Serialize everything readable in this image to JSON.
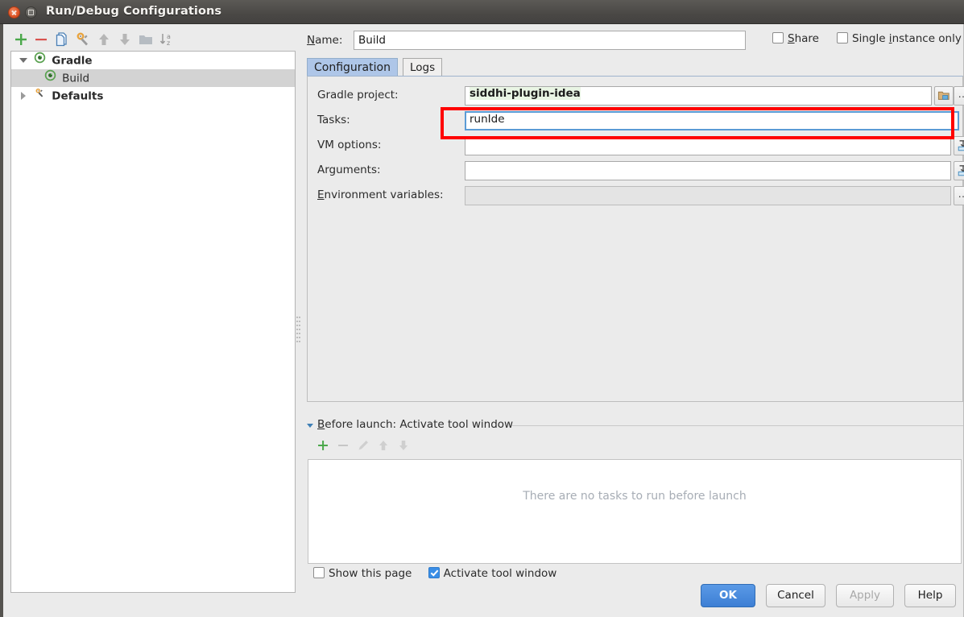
{
  "window": {
    "title": "Run/Debug Configurations",
    "close_icon": "close-icon",
    "maximize_icon": "maximize-icon"
  },
  "left_toolbar": {
    "buttons": [
      {
        "name": "add-configuration-button",
        "icon": "plus-icon",
        "enabled": true
      },
      {
        "name": "remove-configuration-button",
        "icon": "minus-icon",
        "enabled": true
      },
      {
        "name": "copy-configuration-button",
        "icon": "copy-icon",
        "enabled": true
      },
      {
        "name": "edit-defaults-button",
        "icon": "wrench-icon",
        "enabled": true
      },
      {
        "name": "move-up-button",
        "icon": "arrow-up-icon",
        "enabled": false
      },
      {
        "name": "move-down-button",
        "icon": "arrow-down-icon",
        "enabled": false
      },
      {
        "name": "new-folder-button",
        "icon": "folder-icon",
        "enabled": false
      },
      {
        "name": "sort-configurations-button",
        "icon": "sort-alpha-icon",
        "enabled": false
      }
    ]
  },
  "tree": {
    "nodes": [
      {
        "label": "Gradle",
        "icon": "gradle-icon",
        "expanded": true,
        "depth": 0,
        "bold": true,
        "selected": false,
        "has_toggle": true
      },
      {
        "label": "Build",
        "icon": "gradle-icon",
        "expanded": false,
        "depth": 1,
        "bold": false,
        "selected": true,
        "has_toggle": false
      },
      {
        "label": "Defaults",
        "icon": "wrench-icon",
        "expanded": false,
        "depth": 0,
        "bold": true,
        "selected": false,
        "has_toggle": true
      }
    ]
  },
  "name_row": {
    "label": "Name:",
    "label_mnemonic": "N",
    "value": "Build",
    "placeholder": "",
    "share": {
      "label": "Share",
      "mnemonic": "S",
      "checked": false
    },
    "single_instance": {
      "label": "Single instance only",
      "mnemonic": "i",
      "checked": false
    }
  },
  "tabs": [
    {
      "label": "Configuration",
      "active": true
    },
    {
      "label": "Logs",
      "active": false
    }
  ],
  "config": {
    "fields": [
      {
        "label": "Gradle project:",
        "mnemonic": "",
        "value": "siddhi-plugin-idea",
        "value_highlighted": true,
        "disabled": false,
        "focused": false,
        "buttons": [
          {
            "name": "browse-gradle-project-button",
            "icon": "folder-open-icon",
            "label": ""
          },
          {
            "name": "gradle-project-more-button",
            "icon": "ellipsis-icon",
            "label": "…"
          }
        ]
      },
      {
        "label": "Tasks:",
        "mnemonic": "",
        "value": "runIde",
        "value_highlighted": false,
        "disabled": false,
        "focused": true,
        "buttons": []
      },
      {
        "label": "VM options:",
        "mnemonic": "",
        "value": "",
        "value_highlighted": false,
        "disabled": false,
        "focused": false,
        "buttons": [
          {
            "name": "vm-options-expand-button",
            "icon": "expand-editor-icon",
            "label": ""
          }
        ]
      },
      {
        "label": "Arguments:",
        "mnemonic": "",
        "value": "",
        "value_highlighted": false,
        "disabled": false,
        "focused": false,
        "buttons": [
          {
            "name": "arguments-expand-button",
            "icon": "expand-editor-icon",
            "label": ""
          }
        ]
      },
      {
        "label": "Environment variables:",
        "mnemonic": "E",
        "value": "",
        "value_highlighted": false,
        "disabled": true,
        "focused": false,
        "buttons": [
          {
            "name": "environment-variables-more-button",
            "icon": "ellipsis-icon",
            "label": "…"
          }
        ]
      }
    ]
  },
  "before_launch": {
    "title": "Before launch: Activate tool window",
    "title_mnemonic": "B",
    "expanded": true,
    "toolbar": [
      {
        "name": "before-launch-add-button",
        "icon": "plus-icon",
        "enabled": true
      },
      {
        "name": "before-launch-remove-button",
        "icon": "minus-icon",
        "enabled": false
      },
      {
        "name": "before-launch-edit-button",
        "icon": "pencil-icon",
        "enabled": false
      },
      {
        "name": "before-launch-move-up-button",
        "icon": "arrow-up-icon",
        "enabled": false
      },
      {
        "name": "before-launch-move-down-button",
        "icon": "arrow-down-icon",
        "enabled": false
      }
    ],
    "empty_text": "There are no tasks to run before launch",
    "show_this_page": {
      "label": "Show this page",
      "checked": false
    },
    "activate_tool_window": {
      "label": "Activate tool window",
      "checked": true
    }
  },
  "dialog_buttons": [
    {
      "label": "OK",
      "style": "primary",
      "enabled": true
    },
    {
      "label": "Cancel",
      "style": "normal",
      "enabled": true
    },
    {
      "label": "Apply",
      "style": "normal",
      "enabled": false
    },
    {
      "label": "Help",
      "style": "normal",
      "enabled": true
    }
  ],
  "annotation": {
    "name": "red-highlight-rectangle",
    "color": "#ff0000",
    "target": "Tasks field"
  },
  "colors": {
    "titlebar": "#4a4845",
    "dialog_background": "#ebebeb",
    "selection": "#d3d3d3",
    "tab_active": "#aec6e8",
    "field_focus_border": "#5b9bd5",
    "value_highlight": "#e9f5e4",
    "primary_button": "#3d7fd4",
    "annotation_red": "#ff0000"
  }
}
